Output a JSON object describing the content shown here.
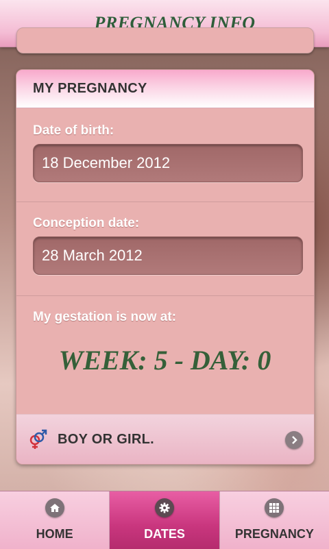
{
  "header": {
    "title": "PREGNANCY INFO"
  },
  "card": {
    "title": "MY PREGNANCY",
    "dob_label": "Date of birth:",
    "dob_value": "18 December 2012",
    "conception_label": "Conception date:",
    "conception_value": "28 March 2012",
    "gestation_label": "My gestation is now at:",
    "gestation_value": "WEEK: 5 - DAY: 0",
    "boygirl_label": "BOY OR GIRL."
  },
  "icons": {
    "gender": "gender-symbol-icon",
    "chevron": "chevron-right-icon",
    "home": "home-icon",
    "dates": "gear-icon",
    "pregnancy": "grid-icon"
  },
  "nav": [
    {
      "label": "HOME",
      "active": false
    },
    {
      "label": "DATES",
      "active": true
    },
    {
      "label": "PREGNANCY",
      "active": false
    }
  ],
  "colors": {
    "title_green": "#2e5e3a",
    "active_tab": "#c9367e",
    "tab_pink": "#f0b2cb"
  }
}
